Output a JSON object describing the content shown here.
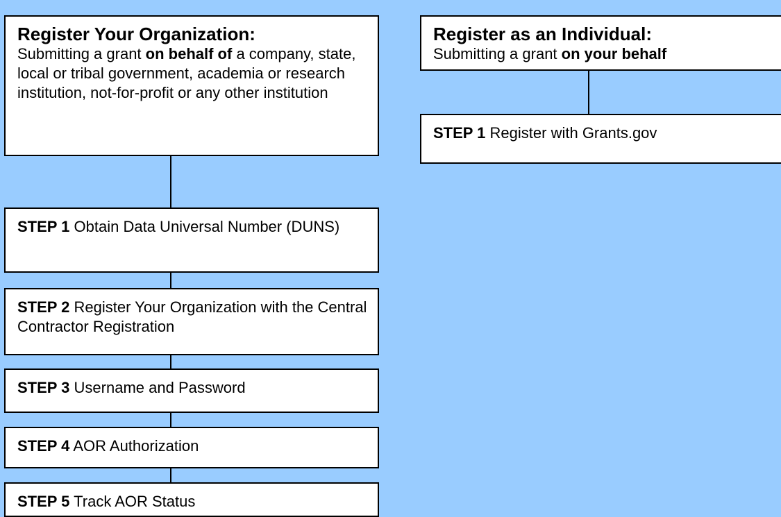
{
  "organization": {
    "title": "Register Your Organization:",
    "desc_prefix": "Submitting a grant ",
    "desc_bold": "on behalf of",
    "desc_suffix": " a company, state, local or tribal government, academia or research institution, not-for-profit or any other institution",
    "steps": [
      {
        "label": "STEP 1",
        "text": "Obtain Data Universal Number (DUNS)"
      },
      {
        "label": "STEP 2",
        "text": "Register Your Organization with the Central Contractor Registration"
      },
      {
        "label": "STEP 3",
        "text": "Username and Password"
      },
      {
        "label": "STEP 4",
        "text": "AOR Authorization"
      },
      {
        "label": "STEP 5",
        "text": "Track AOR Status"
      }
    ]
  },
  "individual": {
    "title": "Register as an Individual:",
    "desc_prefix": "Submitting a grant ",
    "desc_bold": "on your behalf",
    "steps": [
      {
        "label": "STEP 1",
        "text": "Register with Grants.gov"
      }
    ]
  },
  "colors": {
    "background": "#99ccff",
    "box": "#ffffff",
    "border": "#000000"
  }
}
